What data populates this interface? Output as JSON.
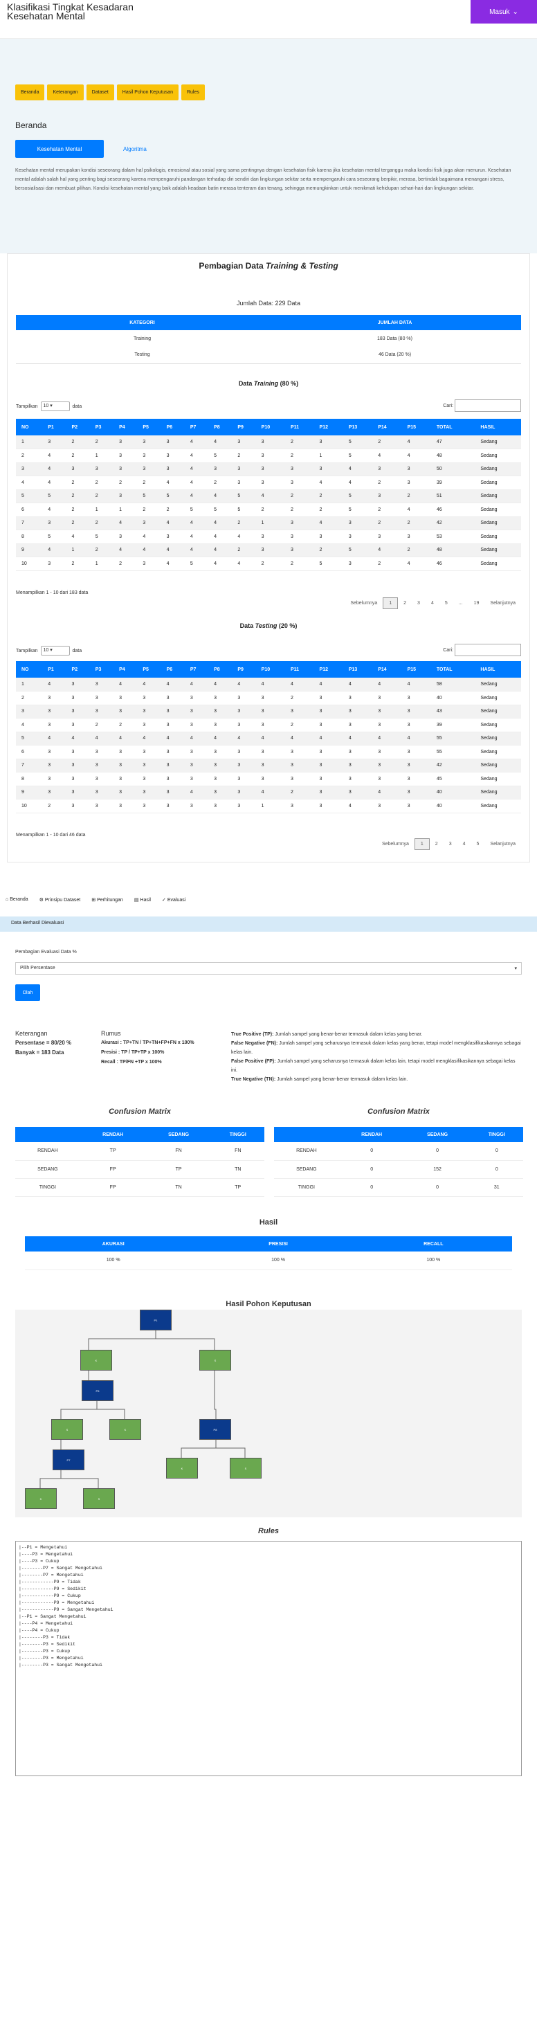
{
  "header": {
    "title": "Klasifikasi Tingkat Kesadaran Kesehatan Mental",
    "login": "Masuk"
  },
  "nav": [
    "Beranda",
    "Keterangan",
    "Dataset",
    "Hasil Pohon Keputusan",
    "Rules"
  ],
  "beranda": {
    "title": "Beranda",
    "tab_active": "Kesehatan Mental",
    "tab": "Algoritma",
    "text": "Kesehatan mental merupakan kondisi seseorang dalam hal psikologis, emosional atau sosial yang sama pentingnya dengan kesehatan fisik karena jika kesehatan mental terganggu maka kondisi fisik juga akan menurun. Kesehatan mental adalah salah hal yang penting bagi seseorang karena mempengaruhi pandangan terhadap diri sendiri dan lingkungan sekitar serta mempengaruhi cara seseorang berpikir, merasa, bertindak bagaimana menangani stress, bersosialisasi dan membuat pilihan. Kondisi kesehatan mental yang baik adalah keadaan batin merasa tenteram dan tenang, sehingga memungkinkan untuk menikmati kehidupan sehari-hari dan lingkungan sekitar."
  },
  "split": {
    "title_pre": "Pembagian Data ",
    "title_em": "Training & Testing",
    "total": "Jumlah Data: 229 Data",
    "headers": [
      "KATEGORI",
      "JUMLAH DATA"
    ],
    "rows": [
      [
        "Training",
        "183 Data (80 %)"
      ],
      [
        "Testing",
        "46 Data (20 %)"
      ]
    ]
  },
  "training": {
    "title_pre": "Data ",
    "title_em": "Training",
    "title_post": " (80 %)",
    "show_label": "Tampilkan",
    "show_value": "10",
    "entries_label": "data",
    "search_label": "Cari:",
    "info": "Menampilkan 1 - 10 dari 183 data",
    "pages": [
      "Sebelumnya",
      "1",
      "2",
      "3",
      "4",
      "5",
      "...",
      "19",
      "Selanjutnya"
    ],
    "headers": [
      "NO",
      "P1",
      "P2",
      "P3",
      "P4",
      "P5",
      "P6",
      "P7",
      "P8",
      "P9",
      "P10",
      "P11",
      "P12",
      "P13",
      "P14",
      "P15",
      "TOTAL",
      "HASIL"
    ],
    "rows": [
      [
        "1",
        "3",
        "2",
        "2",
        "3",
        "3",
        "3",
        "4",
        "4",
        "3",
        "3",
        "2",
        "3",
        "5",
        "2",
        "4",
        "47",
        "Sedang"
      ],
      [
        "2",
        "4",
        "2",
        "1",
        "3",
        "3",
        "3",
        "4",
        "5",
        "2",
        "3",
        "2",
        "1",
        "5",
        "4",
        "4",
        "48",
        "Sedang"
      ],
      [
        "3",
        "4",
        "3",
        "3",
        "3",
        "3",
        "3",
        "4",
        "3",
        "3",
        "3",
        "3",
        "3",
        "4",
        "3",
        "3",
        "50",
        "Sedang"
      ],
      [
        "4",
        "4",
        "2",
        "2",
        "2",
        "2",
        "4",
        "4",
        "2",
        "3",
        "3",
        "3",
        "4",
        "4",
        "2",
        "3",
        "39",
        "Sedang"
      ],
      [
        "5",
        "5",
        "2",
        "2",
        "3",
        "5",
        "5",
        "4",
        "4",
        "5",
        "4",
        "2",
        "2",
        "5",
        "3",
        "2",
        "51",
        "Sedang"
      ],
      [
        "6",
        "4",
        "2",
        "1",
        "1",
        "2",
        "2",
        "5",
        "5",
        "5",
        "2",
        "2",
        "2",
        "5",
        "2",
        "4",
        "46",
        "Sedang"
      ],
      [
        "7",
        "3",
        "2",
        "2",
        "4",
        "3",
        "4",
        "4",
        "4",
        "2",
        "1",
        "3",
        "4",
        "3",
        "2",
        "2",
        "42",
        "Sedang"
      ],
      [
        "8",
        "5",
        "4",
        "5",
        "3",
        "4",
        "3",
        "4",
        "4",
        "4",
        "3",
        "3",
        "3",
        "3",
        "3",
        "3",
        "53",
        "Sedang"
      ],
      [
        "9",
        "4",
        "1",
        "2",
        "4",
        "4",
        "4",
        "4",
        "4",
        "2",
        "3",
        "3",
        "2",
        "5",
        "4",
        "2",
        "48",
        "Sedang"
      ],
      [
        "10",
        "3",
        "2",
        "1",
        "2",
        "3",
        "4",
        "5",
        "4",
        "4",
        "2",
        "2",
        "5",
        "3",
        "2",
        "4",
        "46",
        "Sedang"
      ]
    ]
  },
  "testing": {
    "title_pre": "Data ",
    "title_em": "Testing",
    "title_post": " (20 %)",
    "show_label": "Tampilkan",
    "show_value": "10",
    "entries_label": "data",
    "search_label": "Cari:",
    "info": "Menampilkan 1 - 10 dari 46 data",
    "pages": [
      "Sebelumnya",
      "1",
      "2",
      "3",
      "4",
      "5",
      "Selanjutnya"
    ],
    "headers": [
      "NO",
      "P1",
      "P2",
      "P3",
      "P4",
      "P5",
      "P6",
      "P7",
      "P8",
      "P9",
      "P10",
      "P11",
      "P12",
      "P13",
      "P14",
      "P15",
      "TOTAL",
      "HASIL"
    ],
    "rows": [
      [
        "1",
        "4",
        "3",
        "3",
        "4",
        "4",
        "4",
        "4",
        "4",
        "4",
        "4",
        "4",
        "4",
        "4",
        "4",
        "4",
        "58",
        "Sedang"
      ],
      [
        "2",
        "3",
        "3",
        "3",
        "3",
        "3",
        "3",
        "3",
        "3",
        "3",
        "3",
        "2",
        "3",
        "3",
        "3",
        "3",
        "40",
        "Sedang"
      ],
      [
        "3",
        "3",
        "3",
        "3",
        "3",
        "3",
        "3",
        "3",
        "3",
        "3",
        "3",
        "3",
        "3",
        "3",
        "3",
        "3",
        "43",
        "Sedang"
      ],
      [
        "4",
        "3",
        "3",
        "2",
        "2",
        "3",
        "3",
        "3",
        "3",
        "3",
        "3",
        "2",
        "3",
        "3",
        "3",
        "3",
        "39",
        "Sedang"
      ],
      [
        "5",
        "4",
        "4",
        "4",
        "4",
        "4",
        "4",
        "4",
        "4",
        "4",
        "4",
        "4",
        "4",
        "4",
        "4",
        "4",
        "55",
        "Sedang"
      ],
      [
        "6",
        "3",
        "3",
        "3",
        "3",
        "3",
        "3",
        "3",
        "3",
        "3",
        "3",
        "3",
        "3",
        "3",
        "3",
        "3",
        "55",
        "Sedang"
      ],
      [
        "7",
        "3",
        "3",
        "3",
        "3",
        "3",
        "3",
        "3",
        "3",
        "3",
        "3",
        "3",
        "3",
        "3",
        "3",
        "3",
        "42",
        "Sedang"
      ],
      [
        "8",
        "3",
        "3",
        "3",
        "3",
        "3",
        "3",
        "3",
        "3",
        "3",
        "3",
        "3",
        "3",
        "3",
        "3",
        "3",
        "45",
        "Sedang"
      ],
      [
        "9",
        "3",
        "3",
        "3",
        "3",
        "3",
        "3",
        "4",
        "3",
        "3",
        "4",
        "2",
        "3",
        "3",
        "4",
        "3",
        "40",
        "Sedang"
      ],
      [
        "10",
        "2",
        "3",
        "3",
        "3",
        "3",
        "3",
        "3",
        "3",
        "3",
        "1",
        "3",
        "3",
        "4",
        "3",
        "3",
        "40",
        "Sedang"
      ]
    ]
  },
  "menu2": [
    "Beranda",
    "Prinsipu Dataset",
    "Perhitungan",
    "Hasil",
    "Evaluasi"
  ],
  "eval": {
    "band": "Data Berhasil Dievaluasi",
    "label": "Pembagian Evaluasi Data %",
    "select": "Pilih Persentase",
    "button": "Olah",
    "ket_title": "Keterangan",
    "ket_persen": "Persentase = 80/20 %",
    "ket_banyak": "Banyak = 183 Data",
    "rumus_title": "Rumus",
    "rumus": [
      "Akurasi : TP+TN / TP+TN+FP+FN x 100%",
      "Presisi : TP / TP+TP x 100%",
      "Recall : TP/FN +TP x 100%"
    ],
    "defs": [
      [
        "True Positive (TP):",
        " Jumlah sampel yang benar-benar termasuk dalam kelas yang benar."
      ],
      [
        "False Negative (FN):",
        " Jumlah sampel yang seharusnya termasuk dalam kelas yang benar, tetapi model mengklasifikasikannya sebagai kelas lain."
      ],
      [
        "False Positive (FP):",
        " Jumlah sampel yang seharusnya termasuk dalam kelas lain, tetapi model mengklasifikasikannya sebagai kelas ini."
      ],
      [
        "True Negative (TN):",
        " Jumlah sampel yang benar-benar termasuk dalam kelas lain."
      ]
    ]
  },
  "cm1": {
    "title": "Confusion Matrix",
    "headers": [
      "",
      "RENDAH",
      "SEDANG",
      "TINGGI"
    ],
    "rows": [
      [
        "RENDAH",
        "TP",
        "FN",
        "FN"
      ],
      [
        "SEDANG",
        "FP",
        "TP",
        "TN"
      ],
      [
        "TINGGI",
        "FP",
        "TN",
        "TP"
      ]
    ]
  },
  "cm2": {
    "title": "Confusion Matrix",
    "headers": [
      "",
      "RENDAH",
      "SEDANG",
      "TINGGI"
    ],
    "rows": [
      [
        "RENDAH",
        "0",
        "0",
        "0"
      ],
      [
        "SEDANG",
        "0",
        "152",
        "0"
      ],
      [
        "TINGGI",
        "0",
        "0",
        "31"
      ]
    ]
  },
  "hasil": {
    "title": "Hasil",
    "headers": [
      "AKURASI",
      "PRESISI",
      "RECALL"
    ],
    "values": [
      "100 %",
      "100 %",
      "100 %"
    ]
  },
  "tree": {
    "title": "Hasil Pohon Keputusan",
    "nodes": [
      "P1",
      "K",
      "S",
      "P6",
      "S",
      "K",
      "P8",
      "P7",
      "K",
      "S",
      "K",
      "S"
    ]
  },
  "rules": {
    "title": "Rules",
    "text": "|--P1 = Mengetahui\n|----P3 = Mengetahui\n|----P3 = Cukup\n|--------P7 = Sangat Mengetahui\n|--------P7 = Mengetahui\n|------------P9 = Tidak\n|------------P9 = Sedikit\n|------------P9 = Cukup\n|------------P9 = Mengetahui\n|------------P9 = Sangat Mengetahui\n|--P1 = Sangat Mengetahui\n|----P4 = Mengetahui\n|----P4 = Cukup\n|--------P3 = Tidak\n|--------P3 = Sedikit\n|--------P3 = Cukup\n|--------P3 = Mengetahui\n|--------P3 = Sangat Mengetahui"
  }
}
